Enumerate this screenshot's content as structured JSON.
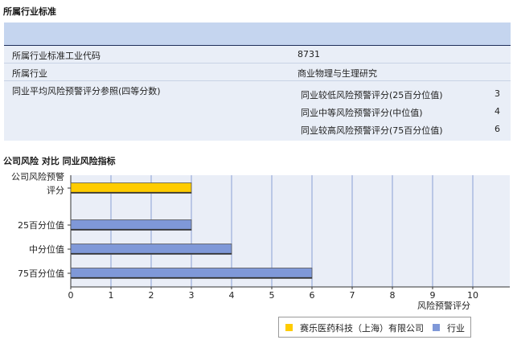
{
  "header": {
    "title": "所属行业标准"
  },
  "industry_info": {
    "rows": [
      {
        "label": "所属行业标准工业代码",
        "value": "8731"
      },
      {
        "label": "所属行业",
        "value": "商业物理与生理研究"
      }
    ],
    "peer_label": "同业平均风险预警评分参照(四等分数)",
    "peer_items": [
      {
        "label": "同业较低风险预警评分(25百分位值)",
        "value": "3"
      },
      {
        "label": "同业中等风险预警评分(中位值)",
        "value": "4"
      },
      {
        "label": "同业较高风险预警评分(75百分位值)",
        "value": "6"
      }
    ]
  },
  "chart_title": "公司风险 对比 同业风险指标",
  "chart_data": {
    "type": "bar",
    "orientation": "horizontal",
    "categories": [
      "公司风险预警评分",
      "25百分位值",
      "中分位值",
      "75百分位值"
    ],
    "category_display": [
      [
        "公司风险预警",
        "评分"
      ],
      [
        "25百分位值"
      ],
      [
        "中分位值"
      ],
      [
        "75百分位值"
      ]
    ],
    "values": [
      3,
      3,
      4,
      6
    ],
    "series": [
      {
        "name": "赛乐医药科技（上海）有限公司",
        "color": "#ffcc00",
        "values": [
          3,
          null,
          null,
          null
        ]
      },
      {
        "name": "行业",
        "color": "#7f98d8",
        "values": [
          null,
          3,
          4,
          6
        ]
      }
    ],
    "xlabel": "风险预警评分",
    "xlim": [
      0,
      10
    ],
    "xticks": [
      "0",
      "1",
      "2",
      "3",
      "4",
      "5",
      "6",
      "7",
      "8",
      "9",
      "10"
    ],
    "grid": true,
    "legend_position": "bottom-right"
  },
  "colors": {
    "plot_bg": "#eaeef7",
    "grid": "#8aa0d4",
    "company": "#ffcc00",
    "industry": "#7f98d8"
  }
}
